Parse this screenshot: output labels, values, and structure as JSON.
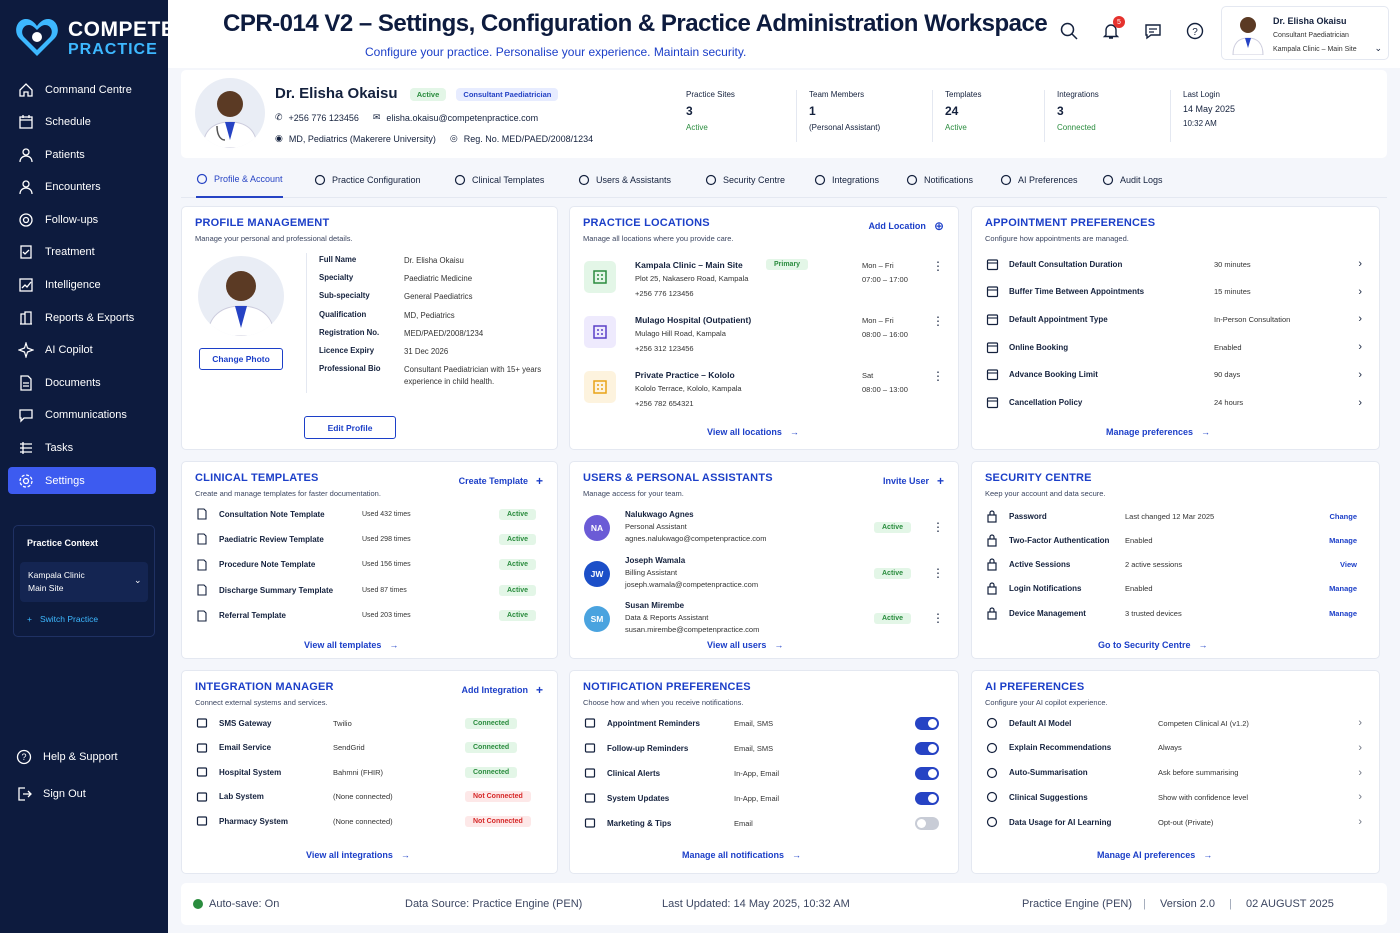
{
  "brand": {
    "line1": "COMPETEN",
    "line2": "PRACTICE"
  },
  "header": {
    "title": "CPR-014 V2 – Settings, Configuration & Practice Administration Workspace",
    "subtitle": "Configure your practice. Personalise your experience. Maintain security.",
    "notification_count": "5",
    "user": {
      "name": "Dr. Elisha Okaisu",
      "role": "Consultant Paediatrician",
      "site": "Kampala Clinic – Main Site"
    }
  },
  "sidebar": {
    "items": [
      {
        "label": "Command Centre",
        "icon": "home-icon"
      },
      {
        "label": "Schedule",
        "icon": "calendar-icon"
      },
      {
        "label": "Patients",
        "icon": "user-icon"
      },
      {
        "label": "Encounters",
        "icon": "user-icon"
      },
      {
        "label": "Follow-ups",
        "icon": "target-icon"
      },
      {
        "label": "Treatment",
        "icon": "clipboard-icon"
      },
      {
        "label": "Intelligence",
        "icon": "chart-icon"
      },
      {
        "label": "Reports & Exports",
        "icon": "building-icon"
      },
      {
        "label": "AI Copilot",
        "icon": "sparkle-icon"
      },
      {
        "label": "Documents",
        "icon": "document-icon"
      },
      {
        "label": "Communications",
        "icon": "chat-icon"
      },
      {
        "label": "Tasks",
        "icon": "tasks-icon"
      },
      {
        "label": "Settings",
        "icon": "gear-icon",
        "active": true
      }
    ],
    "context": {
      "title": "Practice Context",
      "site_line1": "Kampala Clinic",
      "site_line2": "Main Site",
      "switch": "Switch Practice"
    },
    "help": "Help & Support",
    "signout": "Sign Out"
  },
  "profile": {
    "name": "Dr. Elisha Okaisu",
    "status": "Active",
    "role": "Consultant Paediatrician",
    "phone": "+256 776 123456",
    "email": "elisha.okaisu@competenpractice.com",
    "qualification": "MD, Pediatrics (Makerere University)",
    "reg": "Reg. No. MED/PAED/2008/1234",
    "stats": [
      {
        "label": "Practice Sites",
        "value": "3",
        "sub": "Active"
      },
      {
        "label": "Team Members",
        "value": "1",
        "sub": "(Personal Assistant)"
      },
      {
        "label": "Templates",
        "value": "24",
        "sub": "Active"
      },
      {
        "label": "Integrations",
        "value": "3",
        "sub": "Connected"
      },
      {
        "label": "Last Login",
        "value": "14 May 2025",
        "sub": "10:32 AM"
      }
    ]
  },
  "tabs": [
    "Profile & Account",
    "Practice Configuration",
    "Clinical Templates",
    "Users & Assistants",
    "Security Centre",
    "Integrations",
    "Notifications",
    "AI Preferences",
    "Audit Logs"
  ],
  "profile_mgmt": {
    "title": "PROFILE MANAGEMENT",
    "subtitle": "Manage your personal and professional details.",
    "change_photo": "Change Photo",
    "edit": "Edit Profile",
    "fields": [
      {
        "k": "Full Name",
        "v": "Dr. Elisha Okaisu"
      },
      {
        "k": "Specialty",
        "v": "Paediatric Medicine"
      },
      {
        "k": "Sub-specialty",
        "v": "General Paediatrics"
      },
      {
        "k": "Qualification",
        "v": "MD, Pediatrics"
      },
      {
        "k": "Registration No.",
        "v": "MED/PAED/2008/1234"
      },
      {
        "k": "Licence Expiry",
        "v": "31 Dec 2026"
      },
      {
        "k": "Professional Bio",
        "v": "Consultant Paediatrician with 15+ years",
        "v2": "experience in child health."
      }
    ]
  },
  "locations": {
    "title": "PRACTICE LOCATIONS",
    "subtitle": "Manage all locations where you provide care.",
    "add": "Add Location",
    "view_all": "View all locations",
    "items": [
      {
        "name": "Kampala Clinic – Main Site",
        "tag": "Primary",
        "addr": "Plot 25, Nakasero Road, Kampala",
        "phone": "+256 776 123456",
        "days": "Mon – Fri",
        "hours": "07:00 – 17:00",
        "color": "#2a8c3e",
        "bg": "#e3f6e7"
      },
      {
        "name": "Mulago Hospital (Outpatient)",
        "tag": "",
        "addr": "Mulago Hill Road, Kampala",
        "phone": "+256 312 123456",
        "days": "Mon – Fri",
        "hours": "08:00 – 16:00",
        "color": "#5a3fc8",
        "bg": "#eeeafd"
      },
      {
        "name": "Private Practice – Kololo",
        "tag": "",
        "addr": "Kololo Terrace, Kololo, Kampala",
        "phone": "+256 782 654321",
        "days": "Sat",
        "hours": "08:00 – 13:00",
        "color": "#e8a317",
        "bg": "#fdf3de"
      }
    ]
  },
  "appointments": {
    "title": "APPOINTMENT PREFERENCES",
    "subtitle": "Configure how appointments are managed.",
    "manage": "Manage preferences",
    "items": [
      {
        "k": "Default Consultation Duration",
        "v": "30 minutes"
      },
      {
        "k": "Buffer Time Between Appointments",
        "v": "15 minutes"
      },
      {
        "k": "Default Appointment Type",
        "v": "In-Person Consultation"
      },
      {
        "k": "Online Booking",
        "v": "Enabled"
      },
      {
        "k": "Advance Booking Limit",
        "v": "90 days"
      },
      {
        "k": "Cancellation Policy",
        "v": "24 hours"
      }
    ]
  },
  "templates": {
    "title": "CLINICAL TEMPLATES",
    "subtitle": "Create and manage templates for faster documentation.",
    "create": "Create Template",
    "view_all": "View all templates",
    "items": [
      {
        "name": "Consultation Note Template",
        "used": "Used 432 times",
        "status": "Active"
      },
      {
        "name": "Paediatric Review Template",
        "used": "Used 298 times",
        "status": "Active"
      },
      {
        "name": "Procedure Note Template",
        "used": "Used 156 times",
        "status": "Active"
      },
      {
        "name": "Discharge Summary Template",
        "used": "Used 87 times",
        "status": "Active"
      },
      {
        "name": "Referral Template",
        "used": "Used 203 times",
        "status": "Active"
      }
    ]
  },
  "users": {
    "title": "USERS & PERSONAL ASSISTANTS",
    "subtitle": "Manage access for your team.",
    "invite": "Invite User",
    "view_all": "View all users",
    "items": [
      {
        "initials": "NA",
        "name": "Nalukwago Agnes",
        "role": "Personal Assistant",
        "email": "agnes.nalukwago@competenpractice.com",
        "status": "Active",
        "color": "#6b5bd6"
      },
      {
        "initials": "JW",
        "name": "Joseph Wamala",
        "role": "Billing Assistant",
        "email": "joseph.wamala@competenpractice.com",
        "status": "Active",
        "color": "#1c4fc8"
      },
      {
        "initials": "SM",
        "name": "Susan Mirembe",
        "role": "Data & Reports Assistant",
        "email": "susan.mirembe@competenpractice.com",
        "status": "Active",
        "color": "#4aa3df"
      }
    ]
  },
  "security": {
    "title": "SECURITY CENTRE",
    "subtitle": "Keep your account and data secure.",
    "go": "Go to Security Centre",
    "items": [
      {
        "k": "Password",
        "v": "Last changed 12 Mar 2025",
        "a": "Change"
      },
      {
        "k": "Two-Factor Authentication",
        "v": "Enabled",
        "a": "Manage"
      },
      {
        "k": "Active Sessions",
        "v": "2 active sessions",
        "a": "View"
      },
      {
        "k": "Login Notifications",
        "v": "Enabled",
        "a": "Manage"
      },
      {
        "k": "Device Management",
        "v": "3 trusted devices",
        "a": "Manage"
      }
    ]
  },
  "integrations": {
    "title": "INTEGRATION MANAGER",
    "subtitle": "Connect external systems and services.",
    "add": "Add Integration",
    "view_all": "View all integrations",
    "items": [
      {
        "k": "SMS Gateway",
        "v": "Twilio",
        "s": "Connected",
        "ok": true
      },
      {
        "k": "Email Service",
        "v": "SendGrid",
        "s": "Connected",
        "ok": true
      },
      {
        "k": "Hospital System",
        "v": "Bahmni (FHIR)",
        "s": "Connected",
        "ok": true
      },
      {
        "k": "Lab System",
        "v": "(None connected)",
        "s": "Not Connected",
        "ok": false
      },
      {
        "k": "Pharmacy System",
        "v": "(None connected)",
        "s": "Not Connected",
        "ok": false
      }
    ]
  },
  "notifications": {
    "title": "NOTIFICATION PREFERENCES",
    "subtitle": "Choose how and when you receive notifications.",
    "manage": "Manage all notifications",
    "items": [
      {
        "k": "Appointment Reminders",
        "v": "Email, SMS",
        "on": true
      },
      {
        "k": "Follow-up Reminders",
        "v": "Email, SMS",
        "on": true
      },
      {
        "k": "Clinical Alerts",
        "v": "In-App, Email",
        "on": true
      },
      {
        "k": "System Updates",
        "v": "In-App, Email",
        "on": true
      },
      {
        "k": "Marketing & Tips",
        "v": "Email",
        "on": false
      }
    ]
  },
  "ai": {
    "title": "AI PREFERENCES",
    "subtitle": "Configure your AI copilot experience.",
    "manage": "Manage AI preferences",
    "items": [
      {
        "k": "Default AI Model",
        "v": "Competen Clinical AI (v1.2)"
      },
      {
        "k": "Explain Recommendations",
        "v": "Always"
      },
      {
        "k": "Auto-Summarisation",
        "v": "Ask before summarising"
      },
      {
        "k": "Clinical Suggestions",
        "v": "Show with confidence level"
      },
      {
        "k": "Data Usage for AI Learning",
        "v": "Opt-out (Private)"
      }
    ]
  },
  "footer": {
    "autosave": "Auto-save: On",
    "source": "Data Source: Practice Engine (PEN)",
    "updated": "Last Updated: 14 May 2025, 10:32 AM",
    "engine": "Practice Engine (PEN)",
    "version": "Version 2.0",
    "date": "02 AUGUST 2025"
  },
  "colors": {
    "sidebar": "#0d1b3e",
    "accent": "#1c3fc8",
    "active_nav": "#3d5bf0",
    "success": "#2a8c3e",
    "danger": "#d62828"
  }
}
